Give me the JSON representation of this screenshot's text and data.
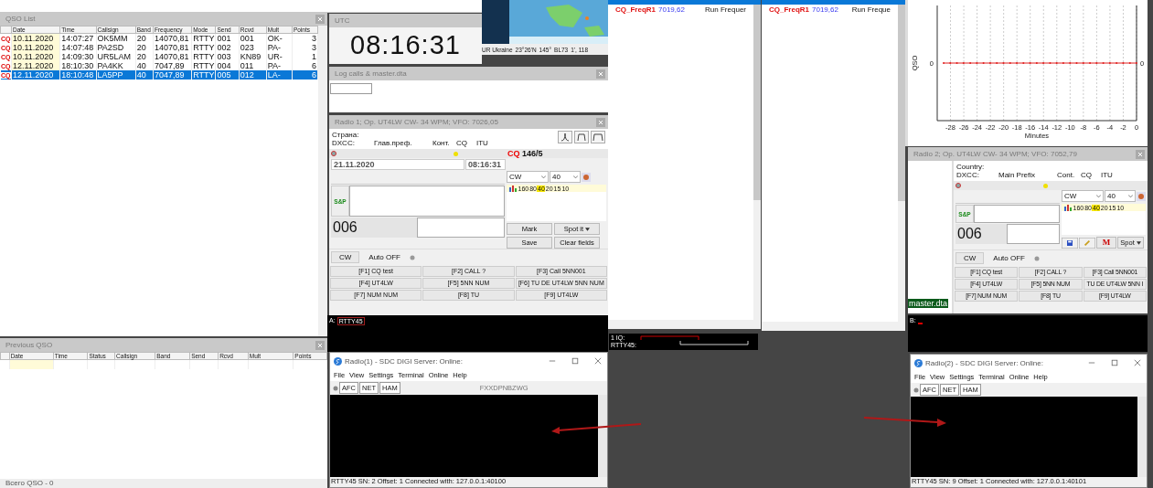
{
  "qso_list": {
    "title": "QSO List",
    "columns": [
      "Date",
      "Time",
      "Callsign",
      "Band",
      "Frequency",
      "Mode",
      "Send",
      "Rcvd",
      "Mult",
      "Points"
    ],
    "rows": [
      {
        "mark": "CQ",
        "cells": [
          "10.11.2020",
          "14:07:27",
          "OK5MM",
          "20",
          "14070,81",
          "RTTY",
          "001",
          "001",
          "OK-",
          "3"
        ],
        "selected": false
      },
      {
        "mark": "CQ",
        "cells": [
          "10.11.2020",
          "14:07:48",
          "PA2SD",
          "20",
          "14070,81",
          "RTTY",
          "002",
          "023",
          "PA-",
          "3"
        ],
        "selected": false
      },
      {
        "mark": "CQ",
        "cells": [
          "10.11.2020",
          "14:09:30",
          "UR5LAM",
          "20",
          "14070,81",
          "RTTY",
          "003",
          "KN89",
          "UR-",
          "1"
        ],
        "selected": false
      },
      {
        "mark": "CQ",
        "cells": [
          "12.11.2020",
          "18:10:30",
          "PA4KK",
          "40",
          "7047,89",
          "RTTY",
          "004",
          "011",
          "PA-",
          "6"
        ],
        "selected": false
      },
      {
        "mark": "CQ",
        "cells": [
          "12.11.2020",
          "18:10:48",
          "LA5PP",
          "40",
          "7047,89",
          "RTTY",
          "005",
          "012",
          "LA-",
          "6"
        ],
        "selected": true
      }
    ]
  },
  "previous_qso": {
    "title": "Previous QSO",
    "columns": [
      "Date",
      "Time",
      "Status",
      "Callsign",
      "Band",
      "Send",
      "Rcvd",
      "Mult",
      "Points"
    ],
    "footer": "Всего QSO - 0"
  },
  "utc": {
    "title": "UTC",
    "time": "08:16:31"
  },
  "map": {
    "status": [
      "UR Ukraine",
      "23°26'N",
      "145°",
      "BL73",
      "1', 118"
    ]
  },
  "log_calls": {
    "title": "Log calls & master.dta"
  },
  "radios": [
    {
      "title": "Radio 1; Op. UT4LW CW- 34 WPM; VFO: 7026,05",
      "country_label": "Страна:",
      "info_labels": [
        "DXCC:",
        "Глав.преф.",
        "Конт.",
        "CQ",
        "ITU"
      ],
      "cq_label": "CQ",
      "cq_value": "146/5",
      "date": "21.11.2020",
      "time": "08:16:31",
      "mode": "CW",
      "band": "40",
      "bands": [
        {
          "label": "160",
          "selected": false
        },
        {
          "label": "80",
          "selected": false
        },
        {
          "label": "40",
          "selected": true
        },
        {
          "label": "20",
          "selected": false
        },
        {
          "label": "15",
          "selected": false
        },
        {
          "label": "10",
          "selected": false
        }
      ],
      "sp": "S&P",
      "serial": "006",
      "buttons": [
        {
          "kind": "text",
          "label": "Mark"
        },
        {
          "kind": "dropdown",
          "label": "Spot it"
        },
        {
          "kind": "text",
          "label": "Save"
        },
        {
          "kind": "text",
          "label": "Clear fields"
        }
      ],
      "key_mode": "CW",
      "auto": "Auto OFF",
      "macros": [
        "[F1] CQ test",
        "[F2] CALL ?",
        "[F3] Call 5NN001",
        "[F4] UT4LW",
        "[F5] 5NN NUM",
        "[F6] TU DE UT4LW 5NN NUM",
        "[F7] NUM NUM",
        "[F8] TU",
        "[F9] UT4LW"
      ]
    },
    {
      "title": "Radio 2; Op. UT4LW CW- 34 WPM; VFO: 7052,79",
      "side_label": "master.dta",
      "country_label": "Country:",
      "info_labels": [
        "DXCC:",
        "Main Prefix",
        "Cont.",
        "CQ",
        "ITU"
      ],
      "mode": "CW",
      "band": "40",
      "bands": [
        {
          "label": "160",
          "selected": false
        },
        {
          "label": "80",
          "selected": false
        },
        {
          "label": "40",
          "selected": true
        },
        {
          "label": "20",
          "selected": false
        },
        {
          "label": "15",
          "selected": false
        },
        {
          "label": "10",
          "selected": false
        }
      ],
      "sp": "S&P",
      "serial": "006",
      "buttons": [
        {
          "kind": "save"
        },
        {
          "kind": "brush"
        },
        {
          "kind": "mark",
          "label": "M"
        },
        {
          "kind": "dropdown",
          "label": "Spot"
        }
      ],
      "key_mode": "CW",
      "auto": "Auto OFF",
      "macros": [
        "[F1] CQ test",
        "[F2] CALL ?",
        "[F3] Call 5NN001",
        "[F4] UT4LW",
        "[F5] 5NN NUM",
        "TU DE UT4LW 5NN I",
        "[F7] NUM NUM",
        "[F8] TU",
        "[F9] UT4LW"
      ]
    }
  ],
  "terminals": [
    {
      "label": "A:",
      "value": "RTTY45"
    },
    {
      "label": "B:"
    }
  ],
  "frequency_lists": [
    {
      "rows": [
        {
          "name": "CQ_FreqR1",
          "freq": "7019,62",
          "note": "Run Frequer"
        }
      ]
    },
    {
      "rows": [
        {
          "name": "CQ_FreqR1",
          "freq": "7019,62",
          "note": "Run Freque"
        }
      ]
    }
  ],
  "iq_panel": {
    "labels": [
      "1 IQ:",
      "RTTY45:"
    ]
  },
  "rate_chart": {
    "x_title": "Minutes",
    "y_title": "QSO",
    "x_labels": [
      "-28",
      "-26",
      "-24",
      "-22",
      "-20",
      "-18",
      "-16",
      "-14",
      "-12",
      "-10",
      "-8",
      "-6",
      "-4",
      "-2",
      "0"
    ],
    "left_label": "0",
    "right_label": "0"
  },
  "digi_windows": [
    {
      "title": "Radio(1) - SDC DIGI Server: Online:",
      "menu": [
        "File",
        "View",
        "Settings",
        "Terminal",
        "Online",
        "Help"
      ],
      "toggles": [
        "AFC",
        "NET",
        "HAM"
      ],
      "callsign": "FXXDPNBZWG",
      "status": "RTTY45 SN: 2  Offset: 1  Connected with: 127.0.0.1:40100"
    },
    {
      "title": "Radio(2) - SDC DIGI Server: Online:",
      "menu": [
        "File",
        "View",
        "Settings",
        "Terminal",
        "Online",
        "Help"
      ],
      "toggles": [
        "AFC",
        "NET",
        "HAM"
      ],
      "status": "RTTY45 SN: 9  Offset: 1  Connected with: 127.0.0.1:40101"
    }
  ]
}
